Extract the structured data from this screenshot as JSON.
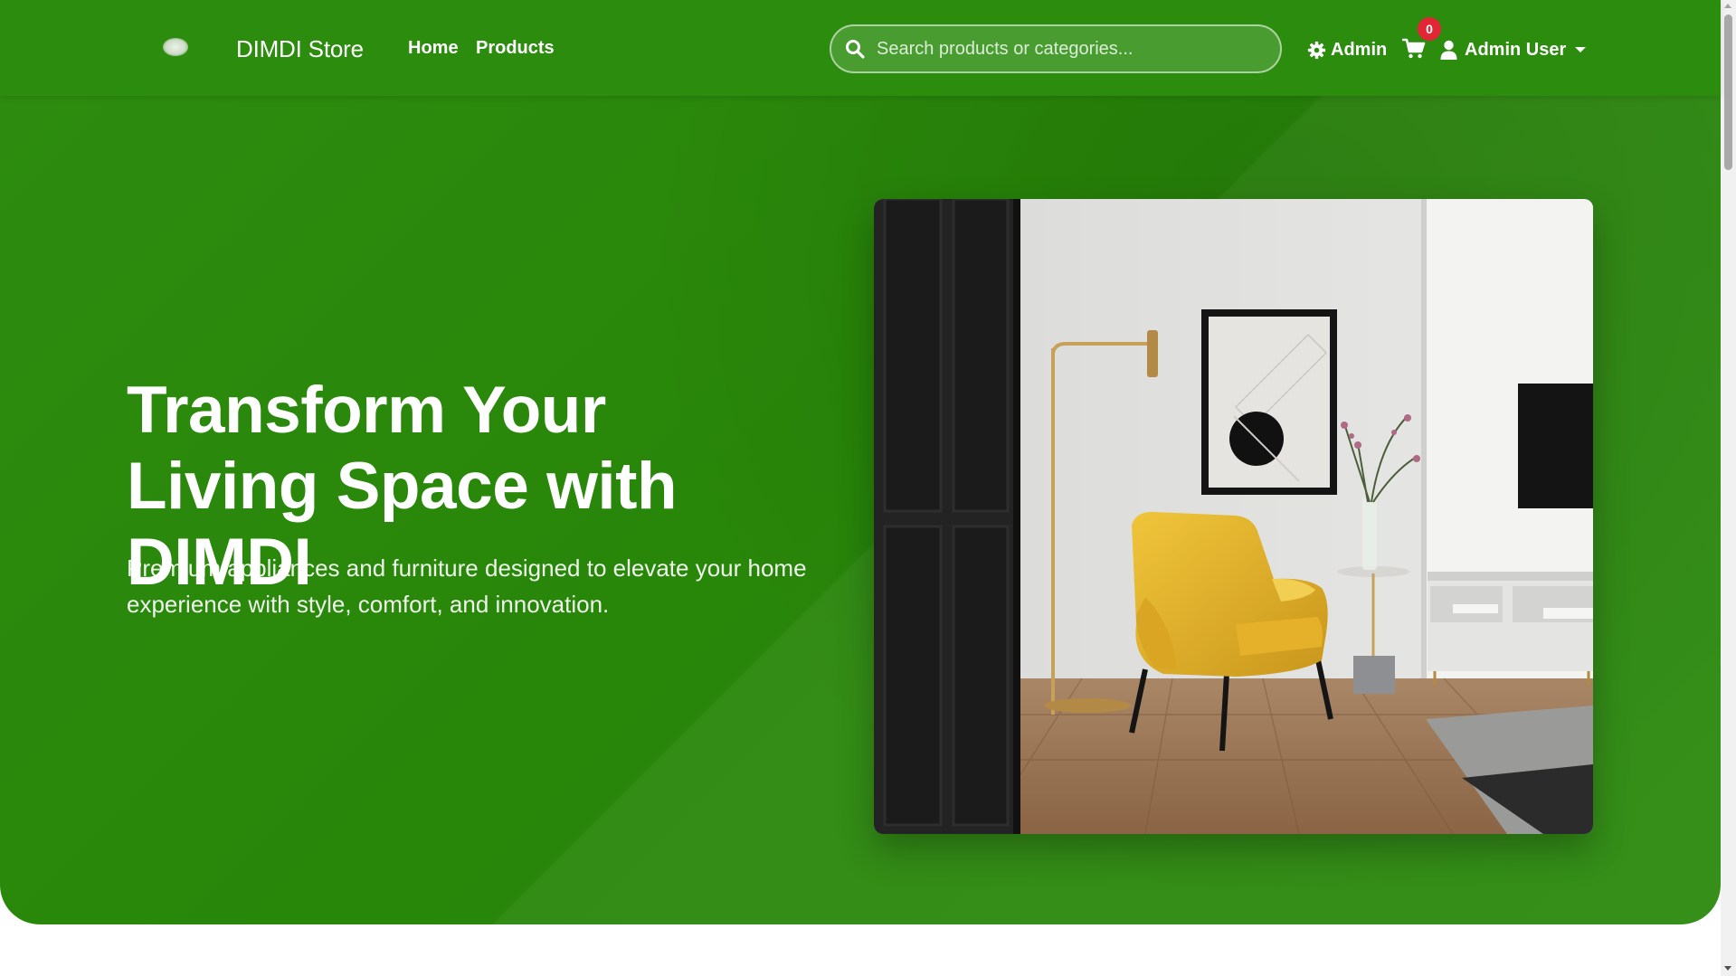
{
  "header": {
    "brand": "DIMDI Store",
    "nav": {
      "home": "Home",
      "products": "Products"
    },
    "search": {
      "placeholder": "Search products or categories..."
    },
    "admin_label": "Admin",
    "cart_count": "0",
    "user_label": "Admin User"
  },
  "hero": {
    "title": "Transform Your Living Space with DIMDI",
    "subtitle": "Premium appliances and furniture designed to elevate your home experience with style, comfort, and innovation."
  },
  "colors": {
    "brand_green": "#2b8c0e",
    "badge_red": "#e32636",
    "text_white": "#ffffff"
  },
  "icons": {
    "search": "search-icon",
    "admin": "gear-icon",
    "cart": "cart-icon",
    "user": "user-icon",
    "dropdown": "chevron-down-icon"
  }
}
